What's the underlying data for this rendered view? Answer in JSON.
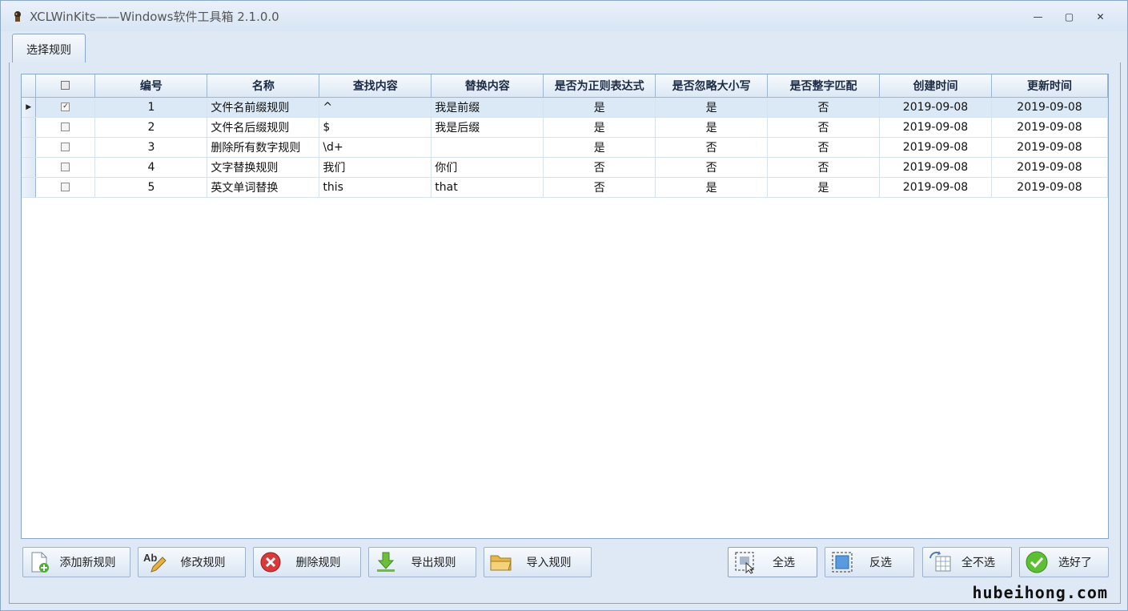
{
  "window": {
    "title": "XCLWinKits——Windows软件工具箱 2.1.0.0",
    "icon": "app-logo-icon",
    "minimize": "—",
    "maximize": "▢",
    "close": "✕"
  },
  "tabs": [
    {
      "label": "选择规则",
      "active": true
    }
  ],
  "grid": {
    "columns": [
      "编号",
      "名称",
      "查找内容",
      "替换内容",
      "是否为正则表达式",
      "是否忽略大小写",
      "是否整字匹配",
      "创建时间",
      "更新时间"
    ],
    "rows": [
      {
        "checked": true,
        "current": true,
        "id": "1",
        "name": "文件名前缀规则",
        "find": "^",
        "replace": "我是前缀",
        "regex": "是",
        "ignore_case": "是",
        "whole_word": "否",
        "created": "2019-09-08",
        "updated": "2019-09-08"
      },
      {
        "checked": false,
        "current": false,
        "id": "2",
        "name": "文件名后缀规则",
        "find": "$",
        "replace": "我是后缀",
        "regex": "是",
        "ignore_case": "是",
        "whole_word": "否",
        "created": "2019-09-08",
        "updated": "2019-09-08"
      },
      {
        "checked": false,
        "current": false,
        "id": "3",
        "name": "删除所有数字规则",
        "find": "\\d+",
        "replace": "",
        "regex": "是",
        "ignore_case": "否",
        "whole_word": "否",
        "created": "2019-09-08",
        "updated": "2019-09-08"
      },
      {
        "checked": false,
        "current": false,
        "id": "4",
        "name": "文字替换规则",
        "find": "我们",
        "replace": "你们",
        "regex": "否",
        "ignore_case": "否",
        "whole_word": "否",
        "created": "2019-09-08",
        "updated": "2019-09-08"
      },
      {
        "checked": false,
        "current": false,
        "id": "5",
        "name": "英文单词替换",
        "find": "this",
        "replace": "that",
        "regex": "否",
        "ignore_case": "是",
        "whole_word": "是",
        "created": "2019-09-08",
        "updated": "2019-09-08"
      }
    ]
  },
  "buttons": {
    "add": {
      "label": "添加新规则",
      "icon": "add-document-icon"
    },
    "edit": {
      "label": "修改规则",
      "icon": "edit-text-icon"
    },
    "delete": {
      "label": "删除规则",
      "icon": "delete-icon"
    },
    "export": {
      "label": "导出规则",
      "icon": "export-icon"
    },
    "import": {
      "label": "导入规则",
      "icon": "folder-icon"
    },
    "select_all": {
      "label": "全选",
      "icon": "select-all-icon"
    },
    "invert": {
      "label": "反选",
      "icon": "invert-selection-icon"
    },
    "select_none": {
      "label": "全不选",
      "icon": "deselect-all-icon"
    },
    "done": {
      "label": "选好了",
      "icon": "checkmark-icon"
    }
  },
  "watermark": "hubeihong.com",
  "colors": {
    "accent": "#8aa6c8",
    "selected_row": "#dbe8f6",
    "delete_red": "#d83a3a",
    "ok_green": "#4caf2f"
  }
}
